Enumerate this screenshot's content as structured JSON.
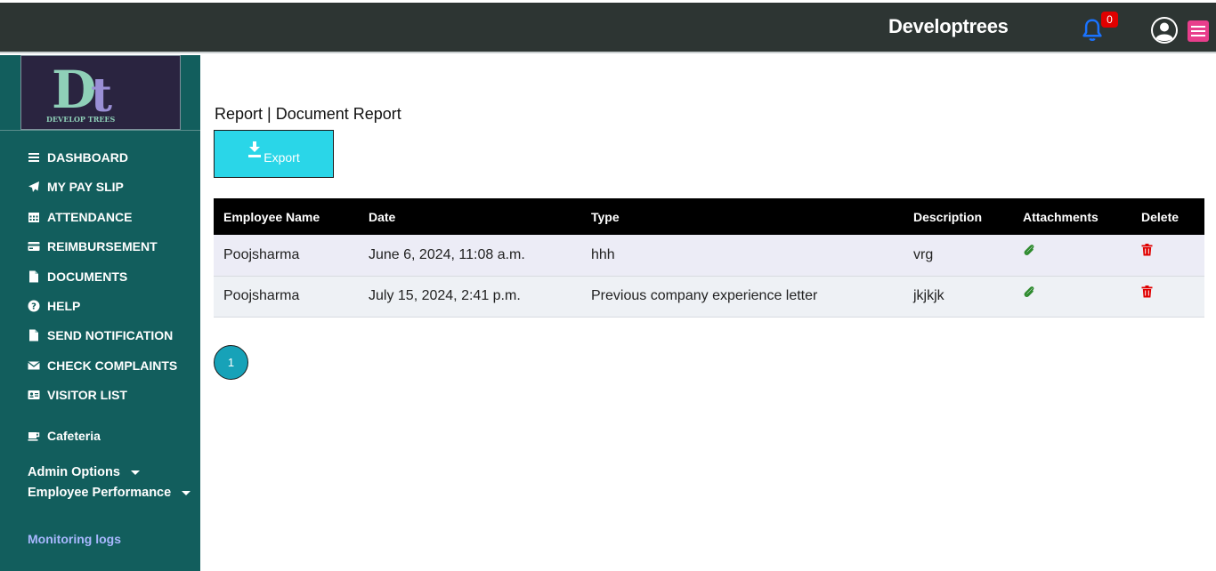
{
  "header": {
    "brand": "Developtrees",
    "notification_count": "0"
  },
  "sidebar": {
    "logo_text": "DEVELOP TREES",
    "items": [
      {
        "label": "DASHBOARD",
        "icon": "bars-icon"
      },
      {
        "label": "MY PAY SLIP",
        "icon": "paper-plane-icon"
      },
      {
        "label": "ATTENDANCE",
        "icon": "calendar-icon"
      },
      {
        "label": "REIMBURSEMENT",
        "icon": "credit-card-icon"
      },
      {
        "label": "DOCUMENTS",
        "icon": "file-icon"
      },
      {
        "label": "HELP",
        "icon": "question-circle-icon"
      },
      {
        "label": "SEND NOTIFICATION",
        "icon": "file-icon"
      },
      {
        "label": "CHECK COMPLAINTS",
        "icon": "envelope-icon"
      },
      {
        "label": "VISITOR LIST",
        "icon": "id-card-icon"
      },
      {
        "label": "Cafeteria",
        "icon": "coffee-icon"
      }
    ],
    "admin_options": "Admin Options",
    "employee_performance": "Employee Performance",
    "monitoring_logs": "Monitoring logs"
  },
  "main": {
    "title": "Report | Document Report",
    "export_label": "Export",
    "table": {
      "headers": [
        "Employee Name",
        "Date",
        "Type",
        "Description",
        "Attachments",
        "Delete"
      ],
      "rows": [
        {
          "employee": "Poojsharma",
          "date": "June 6, 2024, 11:08 a.m.",
          "type": "hhh",
          "description": "vrg"
        },
        {
          "employee": "Poojsharma",
          "date": "July 15, 2024, 2:41 p.m.",
          "type": "Previous company experience letter",
          "description": "jkjkjk"
        }
      ]
    },
    "pagination": {
      "current_page": "1"
    }
  },
  "colors": {
    "topbar": "#2d3533",
    "sidebar": "#125e5d",
    "export_button": "#2ad6e8",
    "attachment_icon": "#2e8b2e",
    "delete_icon": "#e00000",
    "pager": "#17a2b8"
  }
}
